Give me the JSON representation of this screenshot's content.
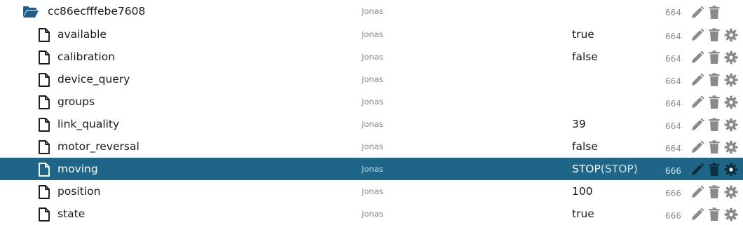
{
  "colors": {
    "selected_row_bg": "#1f6587",
    "folder_icon": "#1f5f8a",
    "action_icon": "#8a8a8a",
    "owner_text": "#8c8c8c"
  },
  "folder": {
    "name": "cc86ecfffebe7608",
    "owner": "Jonas",
    "mode": "664",
    "icons": [
      "folder-open-icon",
      "pencil-icon",
      "trash-icon"
    ]
  },
  "items": [
    {
      "name": "available",
      "owner": "Jonas",
      "value": "true",
      "sub": "",
      "mode": "664",
      "selected": false
    },
    {
      "name": "calibration",
      "owner": "Jonas",
      "value": "false",
      "sub": "",
      "mode": "664",
      "selected": false
    },
    {
      "name": "device_query",
      "owner": "Jonas",
      "value": "",
      "sub": "",
      "mode": "664",
      "selected": false
    },
    {
      "name": "groups",
      "owner": "Jonas",
      "value": "",
      "sub": "",
      "mode": "664",
      "selected": false
    },
    {
      "name": "link_quality",
      "owner": "Jonas",
      "value": "39",
      "sub": "",
      "mode": "664",
      "selected": false
    },
    {
      "name": "motor_reversal",
      "owner": "Jonas",
      "value": "false",
      "sub": "",
      "mode": "664",
      "selected": false
    },
    {
      "name": "moving",
      "owner": "Jonas",
      "value": "STOP",
      "sub": "(STOP)",
      "mode": "666",
      "selected": true
    },
    {
      "name": "position",
      "owner": "Jonas",
      "value": "100",
      "sub": "",
      "mode": "666",
      "selected": false
    },
    {
      "name": "state",
      "owner": "Jonas",
      "value": "true",
      "sub": "",
      "mode": "666",
      "selected": false
    }
  ],
  "item_icons": [
    "file-icon",
    "pencil-icon",
    "trash-icon",
    "gear-icon"
  ]
}
